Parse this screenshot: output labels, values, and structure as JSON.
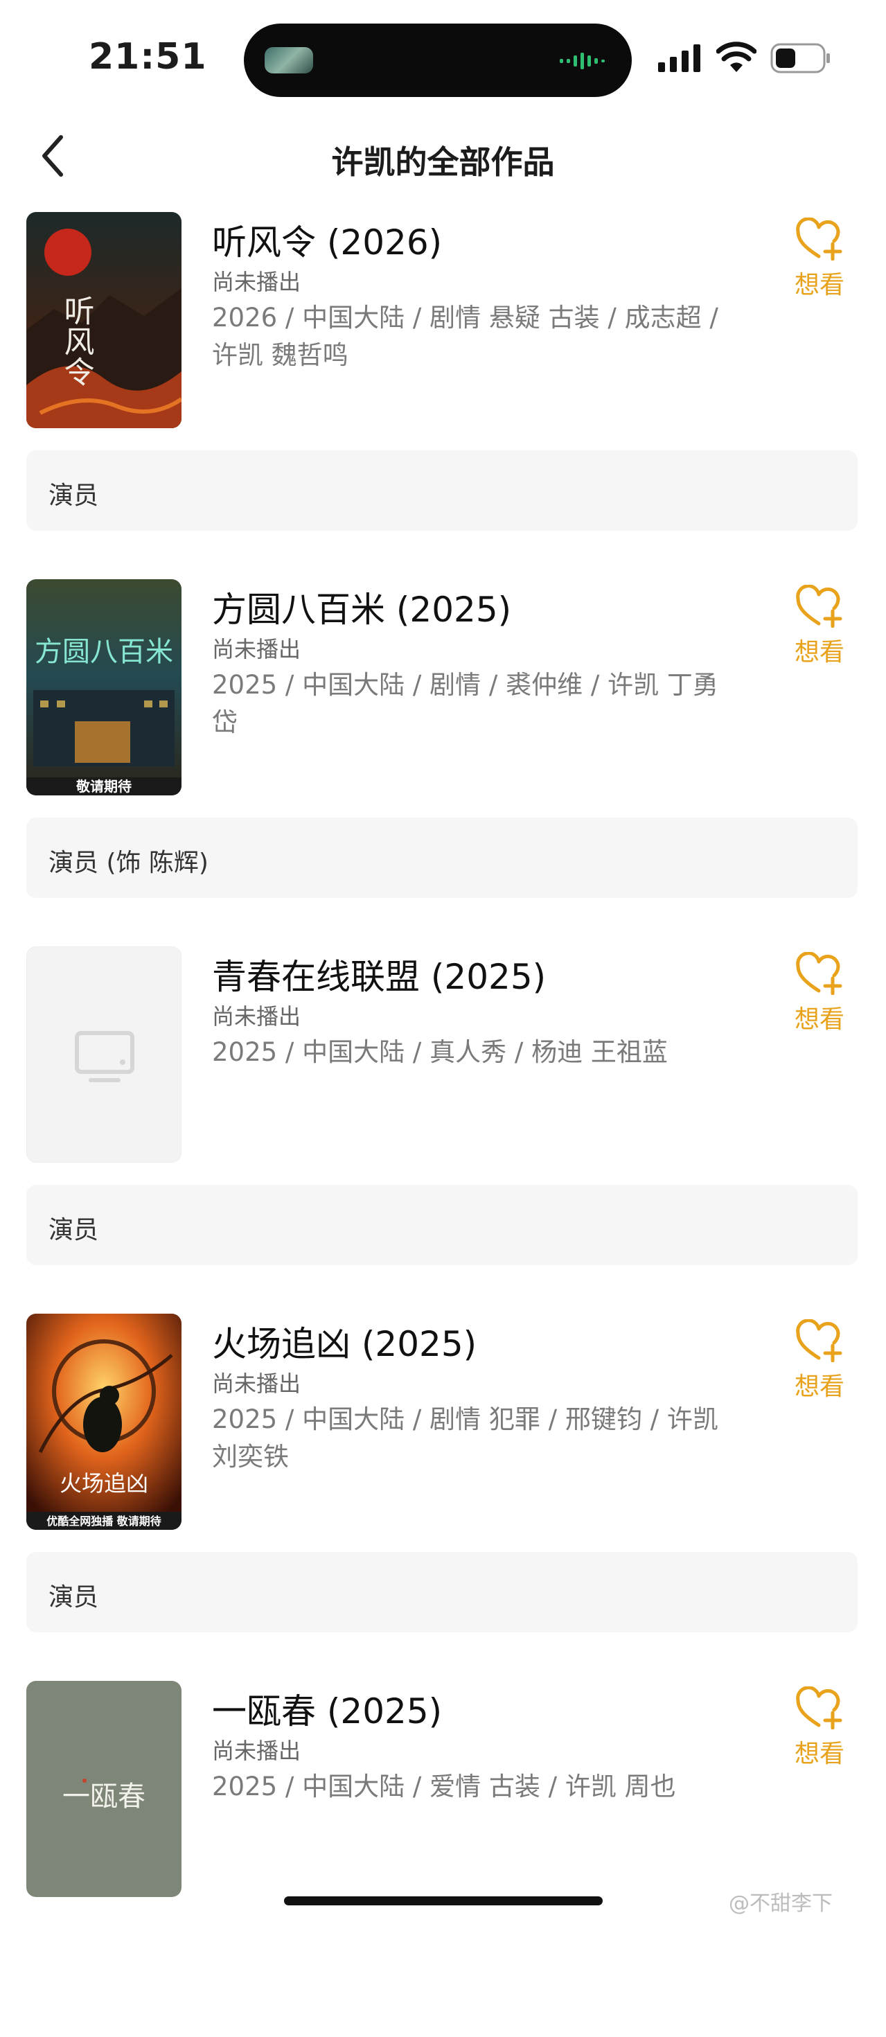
{
  "status_bar": {
    "time": "21:51"
  },
  "nav": {
    "title": "许凯的全部作品",
    "back_icon": "chevron-left-icon"
  },
  "want_label": "想看",
  "items": [
    {
      "title": "听风令 (2026)",
      "status": "尚未播出",
      "meta": "2026 / 中国大陆 / 剧情 悬疑 古装 / 成志超 / 许凯 魏哲鸣",
      "role": "演员"
    },
    {
      "title": "方圆八百米 (2025)",
      "status": "尚未播出",
      "meta": "2025 / 中国大陆 / 剧情 / 裘仲维 / 许凯 丁勇岱",
      "role": "演员 (饰 陈辉)"
    },
    {
      "title": "青春在线联盟 (2025)",
      "status": "尚未播出",
      "meta": "2025 / 中国大陆 / 真人秀 / 杨迪 王祖蓝",
      "role": "演员"
    },
    {
      "title": "火场追凶 (2025)",
      "status": "尚未播出",
      "meta": "2025 / 中国大陆 / 剧情 犯罪 / 邢键钧 / 许凯 刘奕铁",
      "role": "演员"
    },
    {
      "title": "一瓯春 (2025)",
      "status": "尚未播出",
      "meta": "2025 / 中国大陆 / 爱情 古装 / 许凯 周也",
      "role": ""
    }
  ],
  "posters": {
    "item0": {
      "text": "听风令"
    },
    "item1": {
      "text": "方圆八百米",
      "caption": "敬请期待"
    },
    "item3": {
      "text": "火场追凶",
      "caption": "优酷全网独播 敬请期待"
    },
    "item4": {
      "text": "一瓯春"
    }
  },
  "watermark": "@不甜李下",
  "colors": {
    "accent": "#e8a21b",
    "role_bg": "#f6f6f6",
    "meta": "#7a7a7a"
  }
}
